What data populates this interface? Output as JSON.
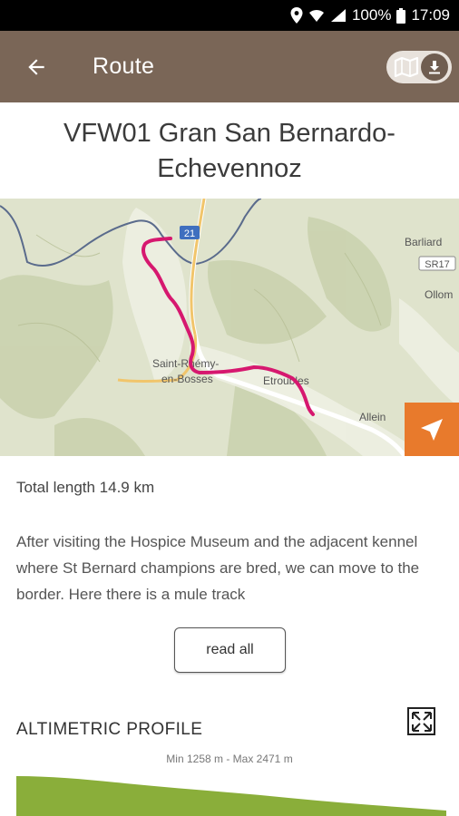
{
  "status": {
    "battery": "100%",
    "time": "17:09"
  },
  "appbar": {
    "title": "Route"
  },
  "route": {
    "title": "VFW01 Gran San Bernardo-Echevennoz",
    "length_text": "Total length 14.9 km",
    "description": "After visiting the Hospice Museum and the adjacent kennel where St Bernard champions are bred, we can move to the border. Here there is a mule track",
    "read_all_label": "read all"
  },
  "map": {
    "labels": {
      "road_21": "21",
      "sr17": "SR17",
      "barliard": "Barliard",
      "ollomont": "Ollom",
      "saint_rhemy_1": "Saint-Rhémy-",
      "saint_rhemy_2": "en-Bosses",
      "etroubles": "Etroubles",
      "allein": "Allein"
    },
    "route_color": "#d6186f",
    "locate_color": "#e87a2c"
  },
  "profile": {
    "title": "ALTIMETRIC PROFILE",
    "minmax": "Min 1258 m - Max 2471 m",
    "fill_color": "#8aae3a"
  }
}
